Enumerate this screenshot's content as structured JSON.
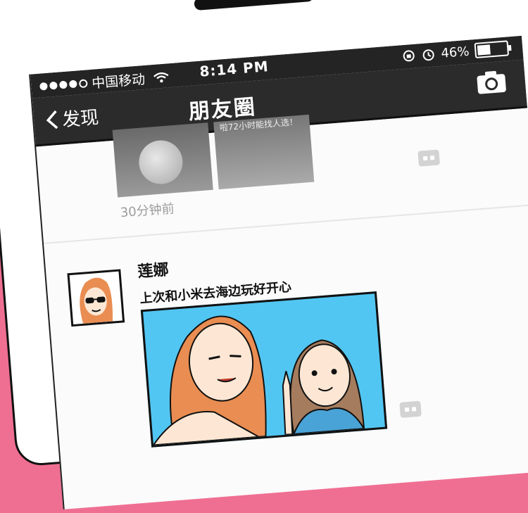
{
  "status_bar": {
    "carrier": "中国移动",
    "time": "8:14 PM",
    "battery_percent": "46%",
    "battery_level": 0.46
  },
  "nav": {
    "back_label": "发现",
    "title": "朋友圈"
  },
  "previous_post": {
    "thumb_text": "啦72小时能找人选！",
    "timestamp": "30分钟前"
  },
  "post": {
    "username": "莲娜",
    "text": "上次和小米去海边玩好开心"
  },
  "colors": {
    "background": "#ef6f92",
    "photo_bg": "#52c6f2",
    "bar": "#2b2b2b"
  }
}
